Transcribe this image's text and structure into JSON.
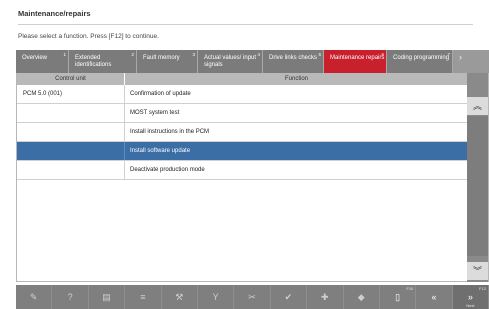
{
  "header": {
    "title": "Maintenance/repairs",
    "instruction": "Please select a function. Press [F12] to continue."
  },
  "tabs": [
    {
      "label": "Overview",
      "key": "1",
      "active": false
    },
    {
      "label": "Extended identifications",
      "key": "2",
      "active": false
    },
    {
      "label": "Fault memory",
      "key": "3",
      "active": false
    },
    {
      "label": "Actual values/ input signals",
      "key": "4",
      "active": false
    },
    {
      "label": "Drive links checks",
      "key": "5",
      "active": false
    },
    {
      "label": "Maintenance repairs",
      "key": "6",
      "active": true
    },
    {
      "label": "Coding programming",
      "key": "7",
      "active": false
    },
    {
      "label": "›",
      "key": "",
      "active": false
    }
  ],
  "table": {
    "columns": [
      "Control unit",
      "Function"
    ],
    "rows": [
      {
        "unit": "PCM 5.0 (001)",
        "function": "Confirmation of update",
        "selected": false
      },
      {
        "unit": "",
        "function": "MOST system test",
        "selected": false
      },
      {
        "unit": "",
        "function": "Install instructions in the PCM",
        "selected": false
      },
      {
        "unit": "",
        "function": "Install software update",
        "selected": true
      },
      {
        "unit": "",
        "function": "Deactivate production mode",
        "selected": false
      }
    ]
  },
  "scrollbar": {
    "up_icon": "︽",
    "down_icon": "︾"
  },
  "toolbar": {
    "buttons": [
      {
        "icon": "✎",
        "name": "tool-icon"
      },
      {
        "icon": "?",
        "name": "help-icon"
      },
      {
        "icon": "▤",
        "name": "list-icon"
      },
      {
        "icon": "≡",
        "name": "menu-icon"
      },
      {
        "icon": "⚒",
        "name": "hammer-icon"
      },
      {
        "icon": "Y",
        "name": "filter-icon"
      },
      {
        "icon": "✂",
        "name": "cut-icon"
      },
      {
        "icon": "✔",
        "name": "check-icon"
      },
      {
        "icon": "✚",
        "name": "plus-icon"
      },
      {
        "icon": "◆",
        "name": "diamond-icon"
      }
    ],
    "f_buttons": [
      {
        "icon": "▯",
        "key": "F10",
        "sub": "",
        "name": "document-icon"
      },
      {
        "icon": "«",
        "key": "",
        "sub": "",
        "name": "back-icon"
      },
      {
        "icon": "»",
        "key": "F12",
        "sub": "Next",
        "name": "next-icon"
      }
    ]
  },
  "colors": {
    "active_tab": "#c8202c",
    "selected_row": "#3a6ea5",
    "toolbar": "#7f7f7f"
  }
}
